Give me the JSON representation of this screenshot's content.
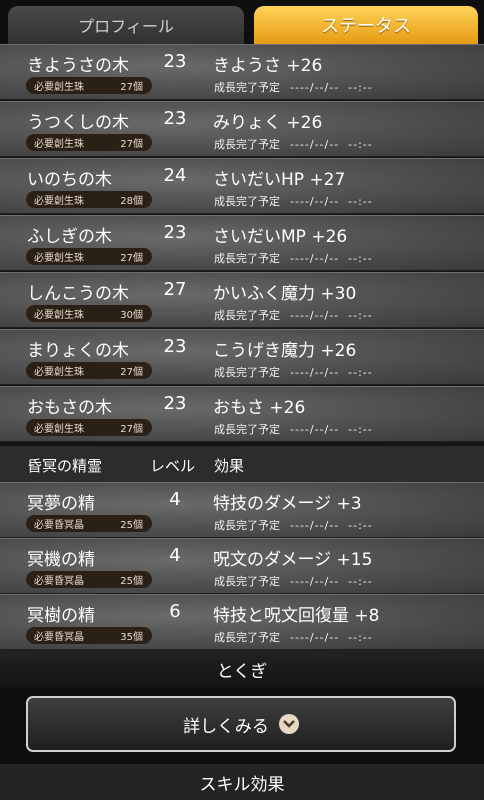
{
  "tabs": {
    "profile": "プロフィール",
    "status": "ステータス"
  },
  "trees": [
    {
      "name": "きようさの木",
      "level": "23",
      "effect": "きようさ +26",
      "req_label": "必要創生珠",
      "req_count": "27個"
    },
    {
      "name": "うつくしの木",
      "level": "23",
      "effect": "みりょく +26",
      "req_label": "必要創生珠",
      "req_count": "27個"
    },
    {
      "name": "いのちの木",
      "level": "24",
      "effect": "さいだいHP +27",
      "req_label": "必要創生珠",
      "req_count": "28個"
    },
    {
      "name": "ふしぎの木",
      "level": "23",
      "effect": "さいだいMP +26",
      "req_label": "必要創生珠",
      "req_count": "27個"
    },
    {
      "name": "しんこうの木",
      "level": "27",
      "effect": "かいふく魔力 +30",
      "req_label": "必要創生珠",
      "req_count": "30個"
    },
    {
      "name": "まりょくの木",
      "level": "23",
      "effect": "こうげき魔力 +26",
      "req_label": "必要創生珠",
      "req_count": "27個"
    },
    {
      "name": "おもさの木",
      "level": "23",
      "effect": "おもさ +26",
      "req_label": "必要創生珠",
      "req_count": "27個"
    }
  ],
  "growth_label": "成長完了予定",
  "growth_value": "----/--/--  --:--",
  "spirits_header": {
    "title": "昏冥の精霊",
    "level": "レベル",
    "effect": "効果"
  },
  "spirits": [
    {
      "name": "冥夢の精",
      "level": "4",
      "effect": "特技のダメージ +3",
      "req_label": "必要昏冥晶",
      "req_count": "25個"
    },
    {
      "name": "冥機の精",
      "level": "4",
      "effect": "呪文のダメージ +15",
      "req_label": "必要昏冥晶",
      "req_count": "25個"
    },
    {
      "name": "冥樹の精",
      "level": "6",
      "effect": "特技と呪文回復量 +8",
      "req_label": "必要昏冥晶",
      "req_count": "35個"
    }
  ],
  "tokugi_label": "とくぎ",
  "detail_button_label": "詳しくみる",
  "skill_effect_label": "スキル効果"
}
